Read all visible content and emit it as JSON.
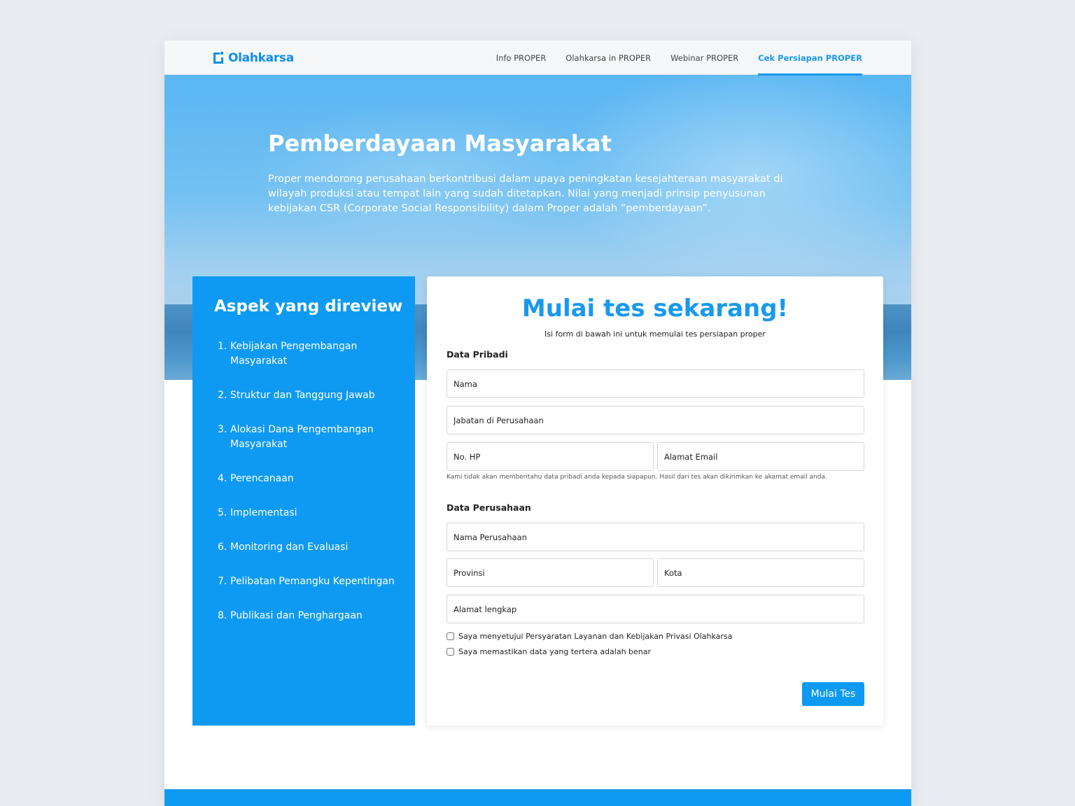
{
  "brand": {
    "name": "Olahkarsa",
    "color": "#0d8fe8"
  },
  "nav": {
    "items": [
      {
        "label": "Info PROPER",
        "active": false
      },
      {
        "label": "Olahkarsa in PROPER",
        "active": false
      },
      {
        "label": "Webinar PROPER",
        "active": false
      },
      {
        "label": "Cek Persiapan PROPER",
        "active": true
      }
    ]
  },
  "hero": {
    "title": "Pemberdayaan Masyarakat",
    "description": "Proper mendorong perusahaan berkontribusi dalam upaya peningkatan kesejahteraan masyarakat di wilayah produksi atau tempat lain yang sudah ditetapkan. Nilai yang menjadi prinsip penyusunan kebijakan CSR (Corporate Social Responsibility) dalam Proper adalah ”pemberdayaan”."
  },
  "aspects": {
    "title": "Aspek yang direview",
    "items": [
      {
        "num": "1.",
        "label": "Kebijakan Pengembangan Masyarakat"
      },
      {
        "num": "2.",
        "label": "Struktur dan Tanggung Jawab"
      },
      {
        "num": "3.",
        "label": "Alokasi Dana Pengembangan Masyarakat"
      },
      {
        "num": "4.",
        "label": "Perencanaan"
      },
      {
        "num": "5.",
        "label": "Implementasi"
      },
      {
        "num": "6.",
        "label": "Monitoring dan Evaluasi"
      },
      {
        "num": "7.",
        "label": "Pelibatan Pemangku Kepentingan"
      },
      {
        "num": "8.",
        "label": "Publikasi dan Penghargaan"
      }
    ]
  },
  "form": {
    "title": "Mulai tes sekarang!",
    "subtitle": "Isi form di bawah ini untuk memulai tes persiapan proper",
    "personal_label": "Data Pribadi",
    "company_label": "Data Perusahaan",
    "placeholders": {
      "nama": "Nama",
      "jabatan": "Jabatan di Perusahaan",
      "hp": "No. HP",
      "email": "Alamat Email",
      "perusahaan": "Nama Perusahaan",
      "provinsi": "Provinsi",
      "kota": "Kota",
      "alamat": "Alamat lengkap"
    },
    "privacy_note": "Kami tidak akan memberitahu data pribadi anda kepada siapapun. Hasil dari tes akan dikirimkan ke akamat email anda.",
    "checkbox_terms": "Saya menyetujui Persyaratan Layanan dan Kebijakan Privasi Olahkarsa",
    "checkbox_confirm": "Saya memastikan data yang tertera adalah benar",
    "submit_label": "Mulai Tes"
  },
  "colors": {
    "accent": "#0e9af2",
    "nav_active": "#1899ee"
  }
}
